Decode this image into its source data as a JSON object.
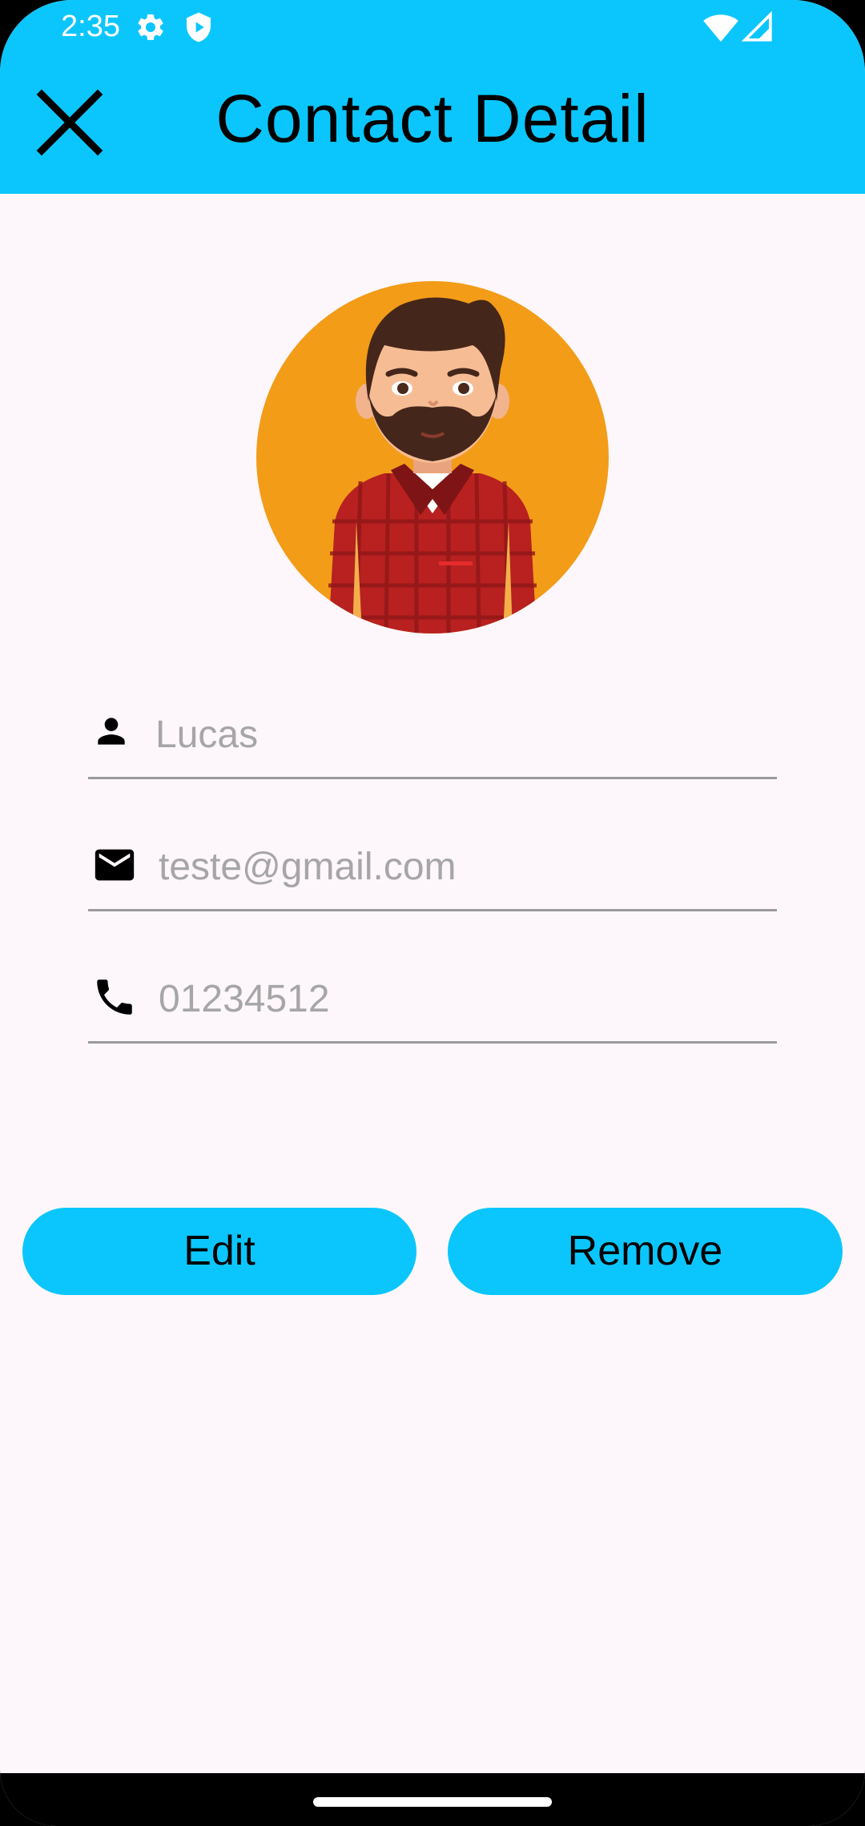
{
  "status_bar": {
    "time": "2:35",
    "icons": [
      "settings-icon",
      "shield-play-icon",
      "wifi-icon",
      "signal-icon"
    ]
  },
  "app_bar": {
    "title": "Contact Detail",
    "close_icon": "close-icon"
  },
  "contact": {
    "avatar": "bearded-man-avatar",
    "fields": {
      "name": {
        "icon": "person-icon",
        "value": "Lucas"
      },
      "email": {
        "icon": "mail-icon",
        "value": "teste@gmail.com"
      },
      "phone": {
        "icon": "phone-icon",
        "value": "01234512"
      }
    }
  },
  "actions": {
    "edit_label": "Edit",
    "remove_label": "Remove"
  },
  "colors": {
    "accent": "#0bc6fc",
    "avatar_bg": "#f39c18",
    "background": "#fdf7fb",
    "hint_text": "#a6a6a6"
  }
}
